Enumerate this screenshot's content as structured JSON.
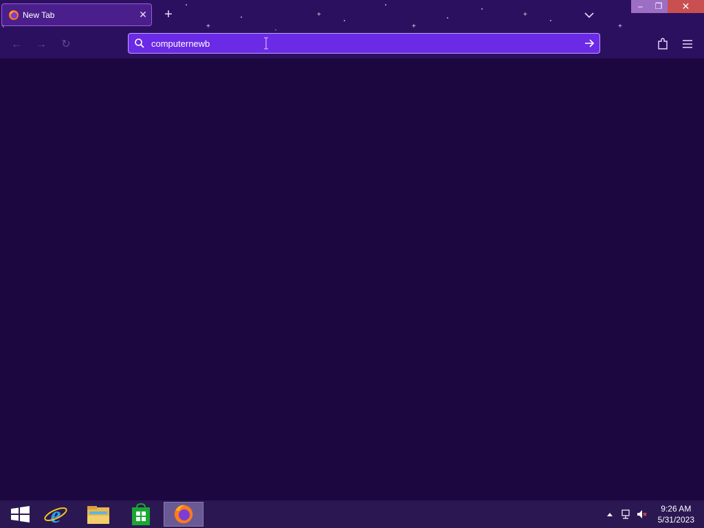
{
  "browser": {
    "tab_title": "New Tab",
    "url_value": "computernewb"
  },
  "icons": {
    "tab_favicon": "firefox-icon",
    "tab_close": "close-icon",
    "new_tab": "plus-icon",
    "tab_list": "chevron-down-icon",
    "back": "back-arrow-icon",
    "forward": "forward-arrow-icon",
    "reload": "reload-icon",
    "search": "search-icon",
    "go": "go-arrow-icon",
    "extensions": "puzzle-icon",
    "menu": "hamburger-menu-icon"
  },
  "taskbar": {
    "time": "9:26 AM",
    "date": "5/31/2023",
    "apps": [
      "start-icon",
      "internet-explorer-icon",
      "file-explorer-icon",
      "store-icon",
      "firefox-icon"
    ]
  },
  "colors": {
    "chrome_bg": "#2c1060",
    "content_bg": "#1d0740",
    "urlbar_bg": "#6b2ae6",
    "taskbar_bg": "#2b1853",
    "close_button": "#c94f50"
  }
}
